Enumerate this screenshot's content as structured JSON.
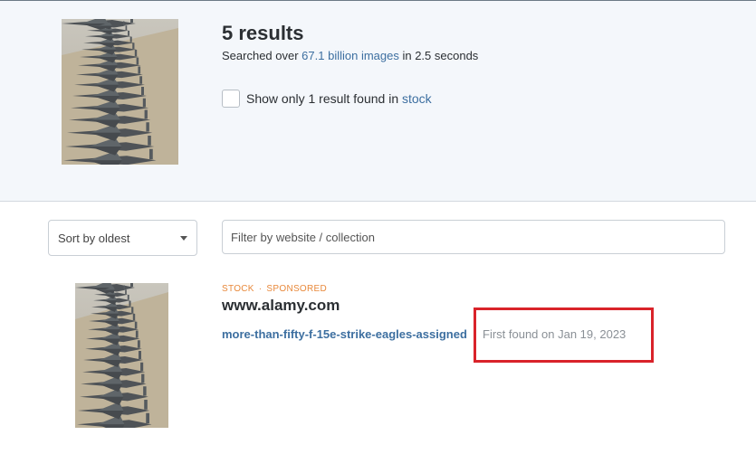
{
  "summary": {
    "results_count": "5 results",
    "searched_prefix": "Searched over ",
    "searched_highlight": "67.1 billion images",
    "searched_suffix": " in 2.5 seconds",
    "stock_filter_prefix": "Show only 1 result found in ",
    "stock_filter_link": "stock",
    "stock_filter_checked": false,
    "query_image_icon": "fighter-jets-photo-icon"
  },
  "controls": {
    "sort_label": "Sort by oldest",
    "filter_placeholder": "Filter by website / collection",
    "filter_value": ""
  },
  "results": [
    {
      "tag_stock": "STOCK",
      "tag_separator": "·",
      "tag_sponsored": "SPONSORED",
      "domain": "www.alamy.com",
      "link_text": "more-than-fifty-f-15e-strike-eagles-assigned",
      "first_found": "First found on Jan 19, 2023",
      "thumbnail_icon": "fighter-jets-photo-icon"
    }
  ],
  "colors": {
    "link": "#3d6fa0",
    "tag": "#e8883a",
    "highlight_box": "#d9232a",
    "panel_background": "#f4f7fb"
  }
}
